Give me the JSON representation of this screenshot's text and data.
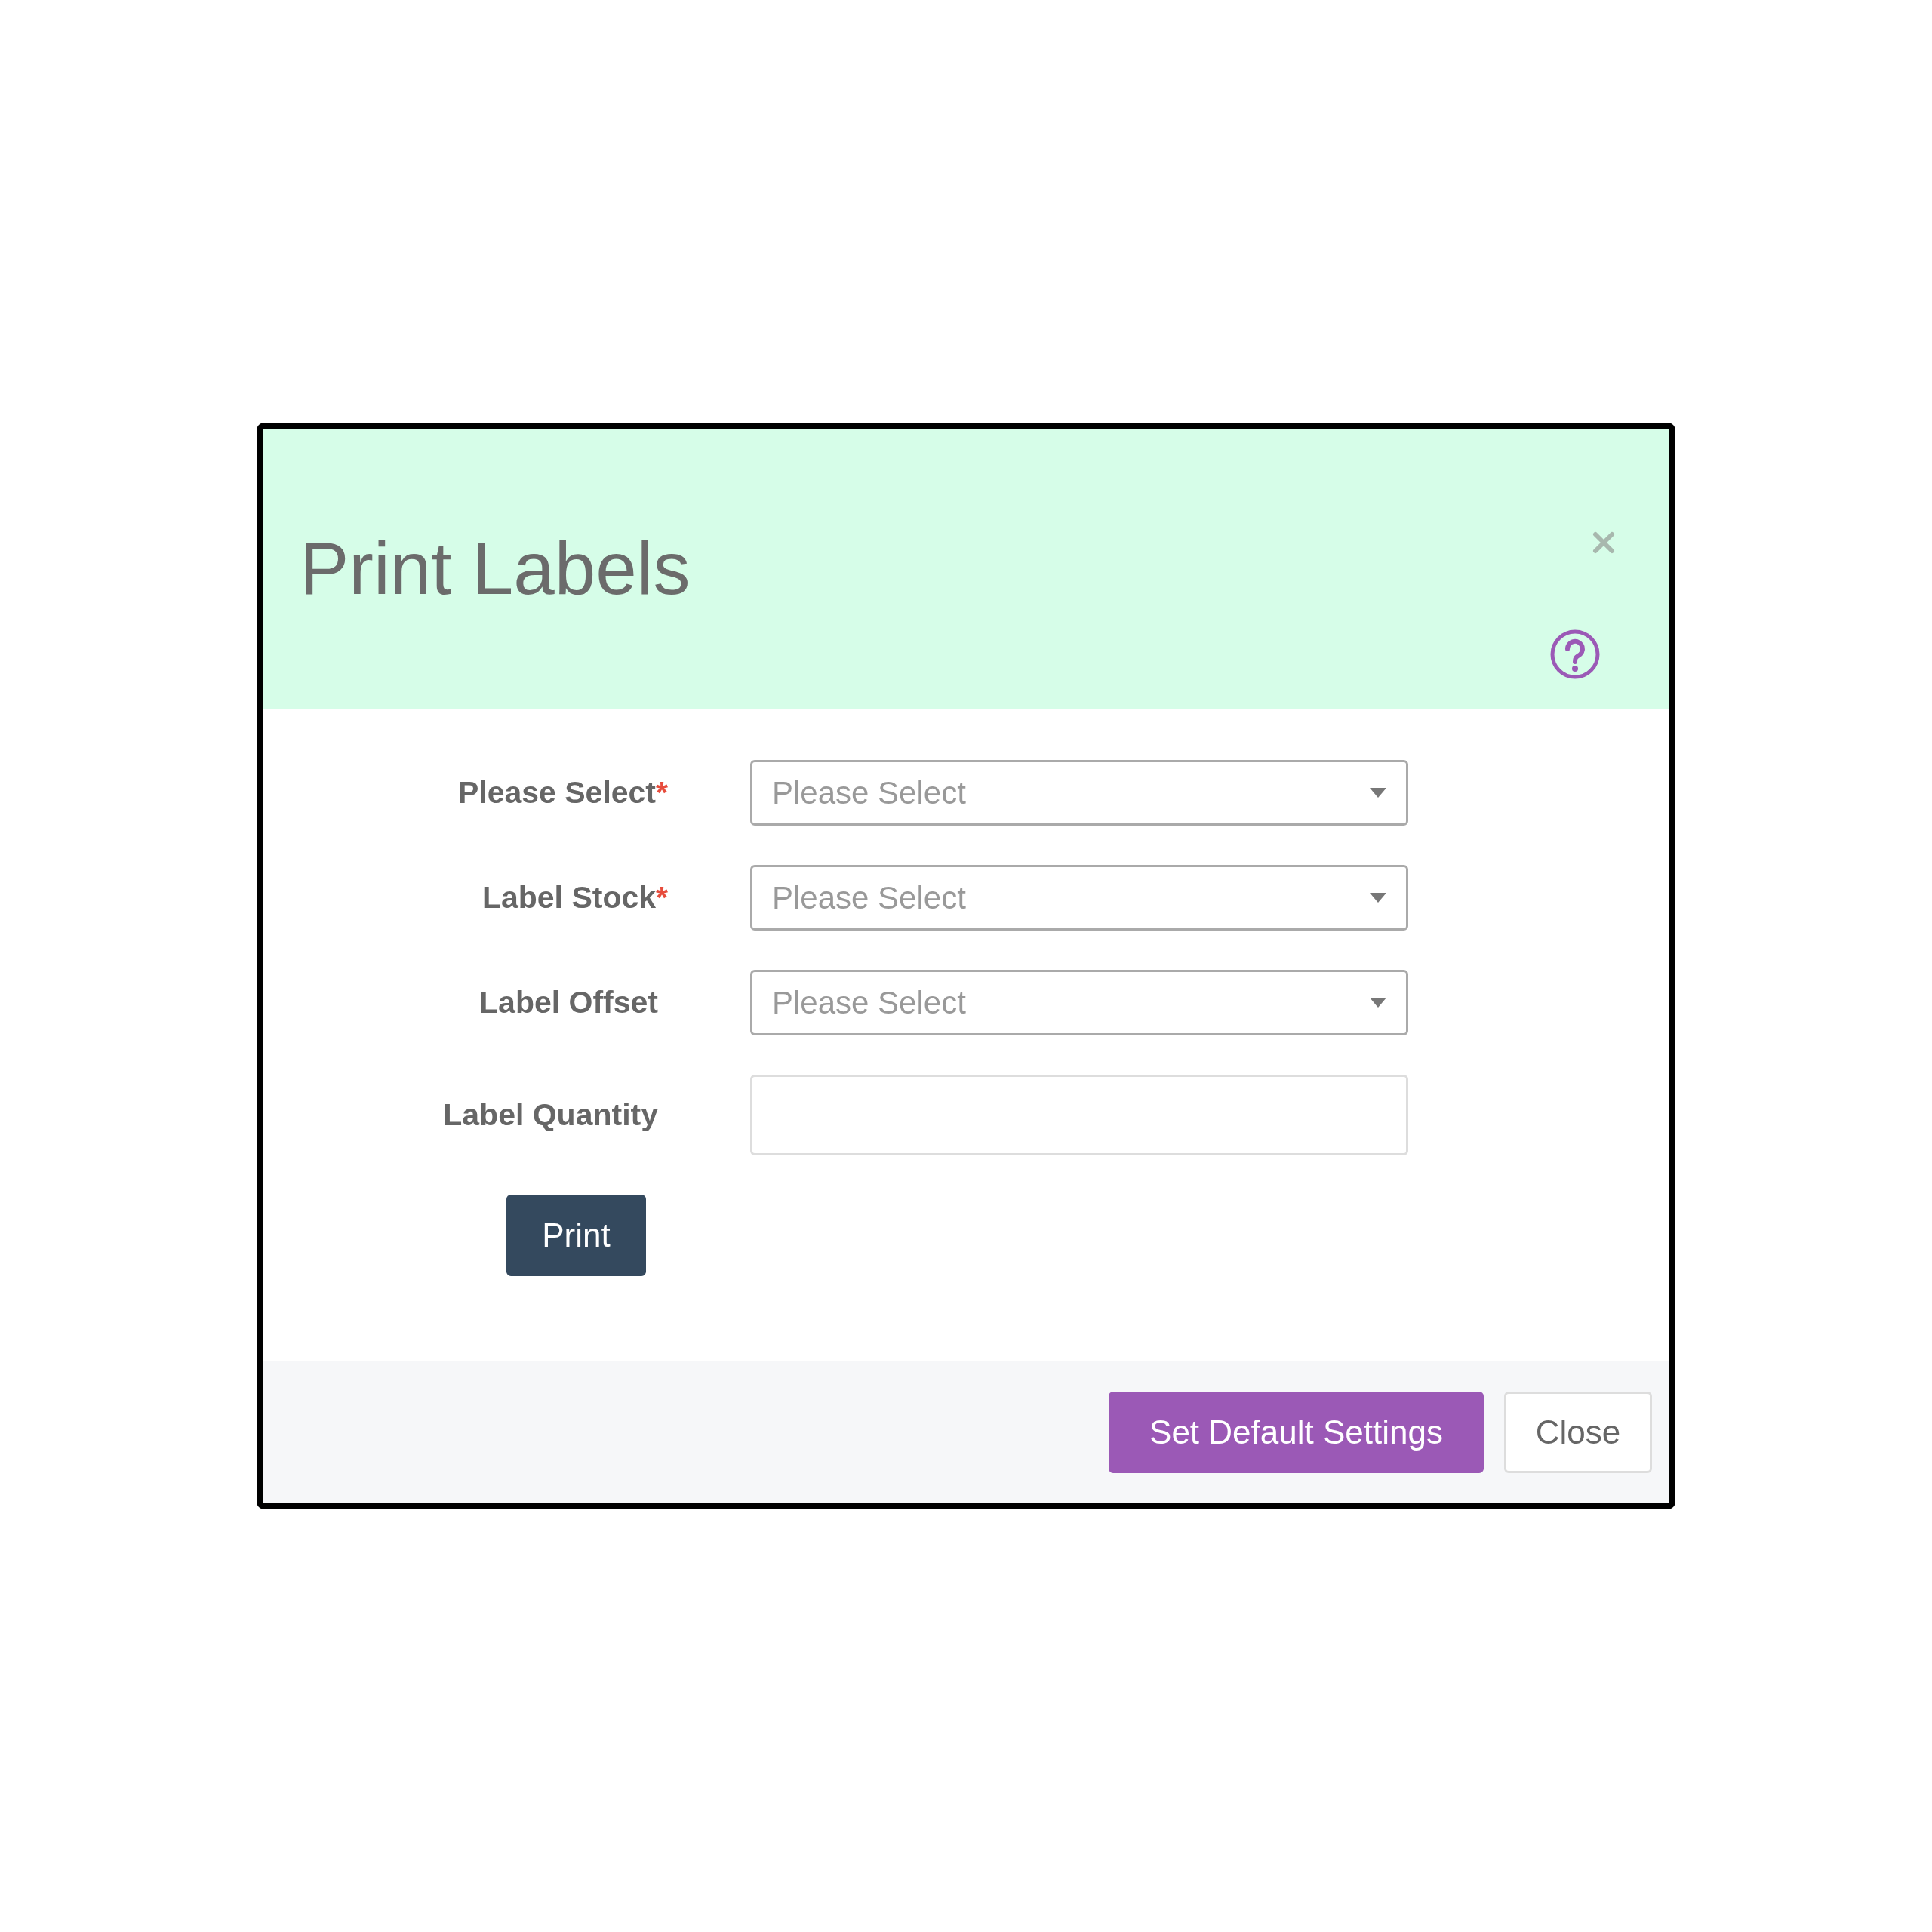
{
  "dialog": {
    "title": "Print Labels",
    "required_mark": "*"
  },
  "fields": [
    {
      "kind": "select",
      "label": "Please Select",
      "required": true,
      "placeholder": "Please Select"
    },
    {
      "kind": "select",
      "label": "Label Stock",
      "required": true,
      "placeholder": "Please Select"
    },
    {
      "kind": "select",
      "label": "Label Offset",
      "required": false,
      "placeholder": "Please Select"
    },
    {
      "kind": "input",
      "label": "Label Quantity",
      "required": false
    }
  ],
  "print_button": "Print",
  "footer_buttons": [
    {
      "label": "Set Default Settings",
      "kind": "primary"
    },
    {
      "label": "Close",
      "kind": "secondary"
    }
  ]
}
